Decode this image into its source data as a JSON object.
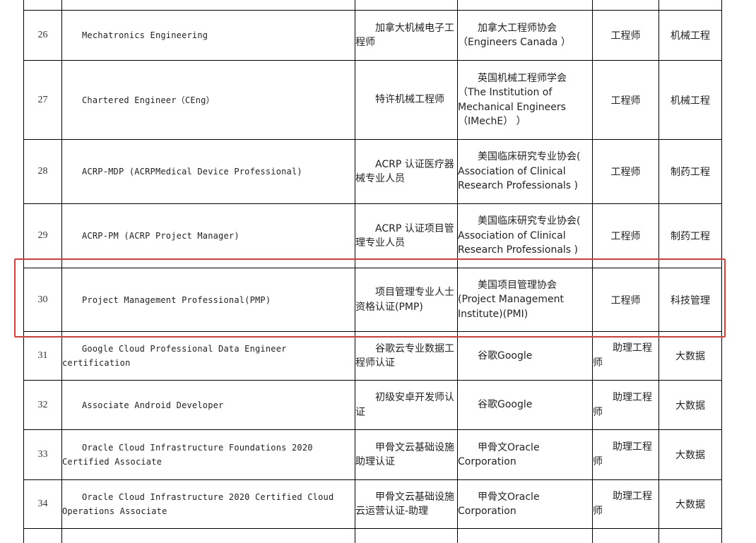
{
  "rows": [
    {
      "no": "26",
      "name": "Mechatronics Engineering",
      "cn": "加拿大机械电子工程师",
      "org": "加拿大工程师协会（Engineers Canada ）",
      "level": "工程师",
      "field": "机械工程"
    },
    {
      "no": "27",
      "name": "Chartered Engineer（CEng）",
      "cn": "特许机械工程师",
      "org": "英国机械工程师学会（The Institution of Mechanical Engineers （IMechE） ）",
      "level": "工程师",
      "field": "机械工程"
    },
    {
      "no": "28",
      "name": "ACRP-MDP (ACRPMedical Device Professional)",
      "cn": "ACRP 认证医疗器械专业人员",
      "org": "美国临床研究专业协会( Association of Clinical Research Professionals )",
      "level": "工程师",
      "field": "制药工程"
    },
    {
      "no": "29",
      "name": "ACRP-PM (ACRP Project Manager)",
      "cn": "ACRP 认证项目管理专业人员",
      "org": "美国临床研究专业协会( Association of Clinical Research Professionals )",
      "level": "工程师",
      "field": "制药工程"
    },
    {
      "no": "30",
      "name": "Project Management Professional(PMP)",
      "cn": "项目管理专业人士资格认证(PMP)",
      "org": "美国项目管理协会(Project Management Institute)(PMI)",
      "level": "工程师",
      "field": "科技管理"
    },
    {
      "no": "31",
      "name": "Google Cloud Professional Data Engineer certification",
      "cn": "谷歌云专业数据工程师认证",
      "org": "谷歌Google",
      "level": "助理工程师",
      "field": "大数据"
    },
    {
      "no": "32",
      "name": "Associate Android Developer",
      "cn": "初级安卓开发师认证",
      "org": "谷歌Google",
      "level": "助理工程师",
      "field": "大数据"
    },
    {
      "no": "33",
      "name": "Oracle Cloud Infrastructure Foundations 2020 Certified Associate",
      "cn": "甲骨文云基础设施助理认证",
      "org": "甲骨文Oracle Corporation",
      "level": "助理工程师",
      "field": "大数据"
    },
    {
      "no": "34",
      "name": "Oracle Cloud Infrastructure 2020 Certified Cloud Operations Associate",
      "cn": "甲骨文云基础设施云运营认证-助理",
      "org": "甲骨文Oracle Corporation",
      "level": "助理工程师",
      "field": "大数据"
    }
  ]
}
